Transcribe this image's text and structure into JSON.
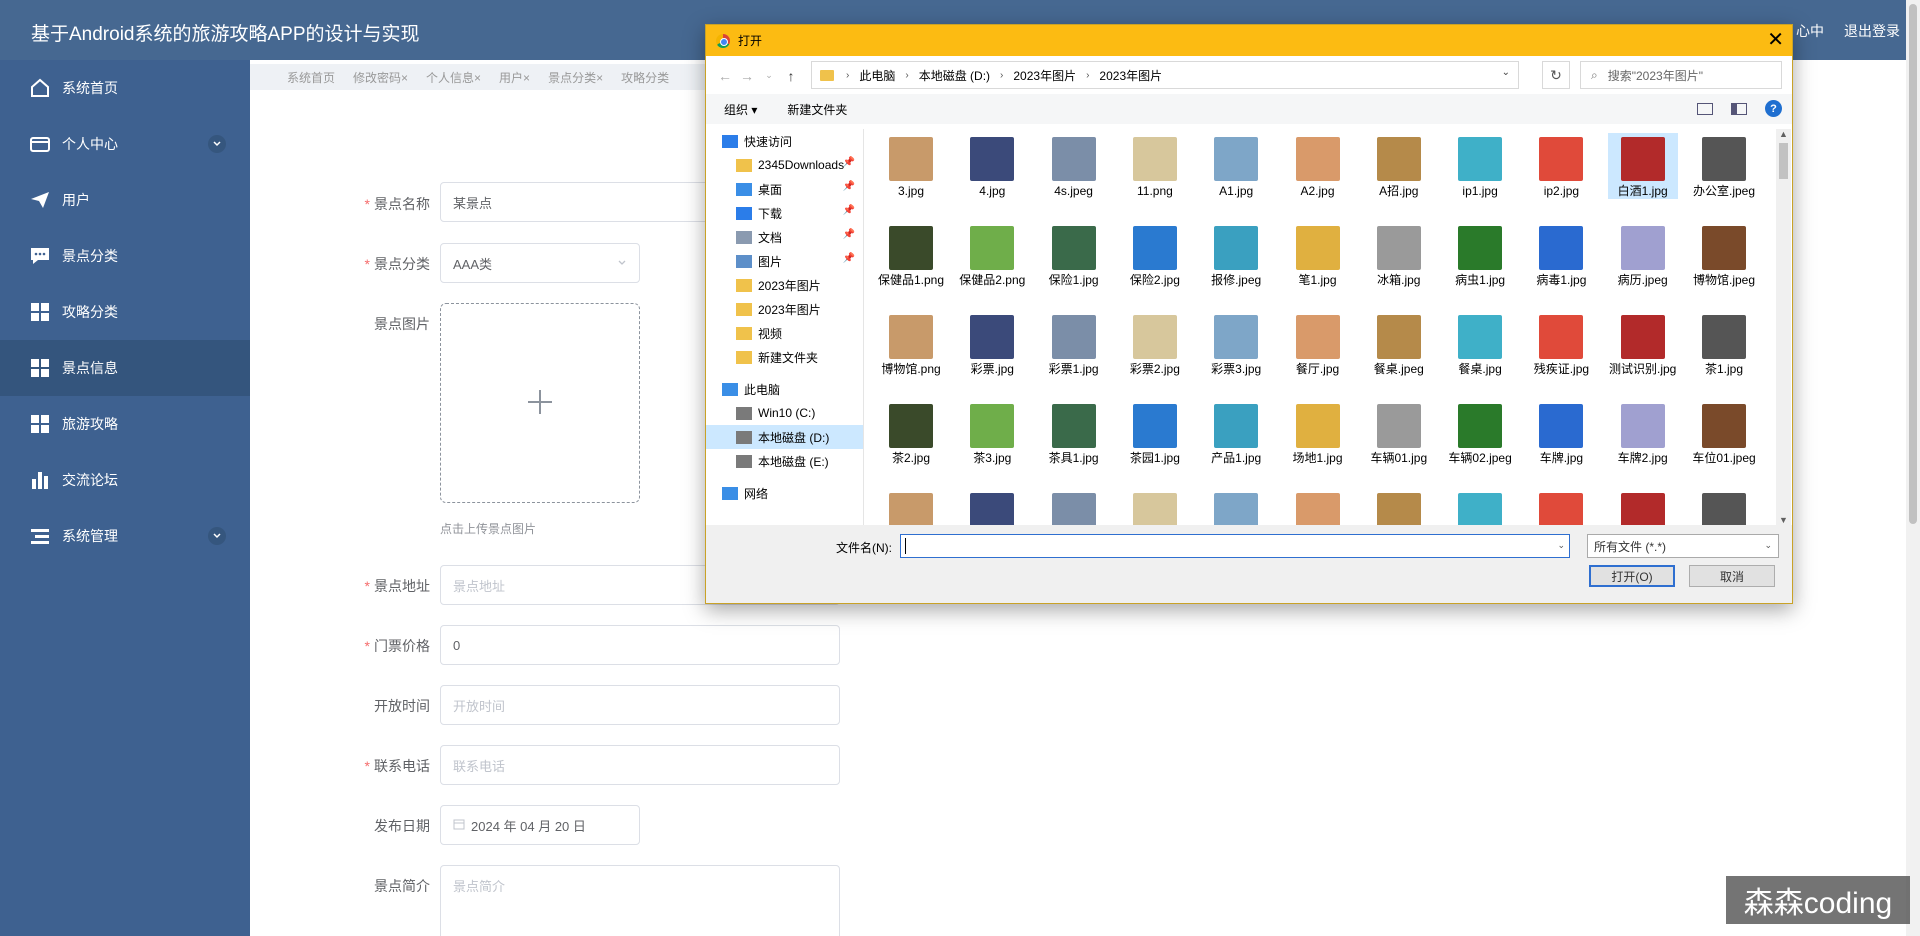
{
  "app": {
    "title": "基于Android系统的旅游攻略APP的设计与实现",
    "top_links": [
      "心中",
      "退出登录"
    ]
  },
  "sidebar": {
    "items": [
      {
        "label": "系统首页"
      },
      {
        "label": "个人中心"
      },
      {
        "label": "用户"
      },
      {
        "label": "景点分类"
      },
      {
        "label": "攻略分类"
      },
      {
        "label": "景点信息"
      },
      {
        "label": "旅游攻略"
      },
      {
        "label": "交流论坛"
      },
      {
        "label": "系统管理"
      }
    ]
  },
  "tags": [
    "系统首页",
    "修改密码×",
    "个人信息×",
    "用户×",
    "景点分类×",
    "攻略分类"
  ],
  "form": {
    "name": {
      "label": "景点名称",
      "value": "某景点"
    },
    "category": {
      "label": "景点分类",
      "value": "AAA类"
    },
    "image": {
      "label": "景点图片",
      "tip": "点击上传景点图片"
    },
    "address": {
      "label": "景点地址",
      "placeholder": "景点地址"
    },
    "price": {
      "label": "门票价格",
      "value": "0"
    },
    "hours": {
      "label": "开放时间",
      "placeholder": "开放时间"
    },
    "phone": {
      "label": "联系电话",
      "placeholder": "联系电话"
    },
    "date": {
      "label": "发布日期",
      "value": "2024 年 04 月 20 日"
    },
    "intro": {
      "label": "景点简介",
      "placeholder": "景点简介"
    }
  },
  "dialog": {
    "title": "打开",
    "breadcrumb": [
      "此电脑",
      "本地磁盘 (D:)",
      "2023年图片",
      "2023年图片"
    ],
    "search_placeholder": "搜索\"2023年图片\"",
    "toolbar": {
      "organize": "组织 ▾",
      "new_folder": "新建文件夹"
    },
    "nav": [
      {
        "label": "快速访问",
        "icon": "star-icon"
      },
      {
        "label": "2345Downloads",
        "icon": "folder-icon",
        "pin": true
      },
      {
        "label": "桌面",
        "icon": "desktop-icon",
        "pin": true
      },
      {
        "label": "下载",
        "icon": "download-icon",
        "pin": true
      },
      {
        "label": "文档",
        "icon": "document-icon",
        "pin": true
      },
      {
        "label": "图片",
        "icon": "picture-icon",
        "pin": true
      },
      {
        "label": "2023年图片",
        "icon": "folder-icon"
      },
      {
        "label": "2023年图片",
        "icon": "folder-icon"
      },
      {
        "label": "视频",
        "icon": "folder-icon"
      },
      {
        "label": "新建文件夹",
        "icon": "folder-icon"
      },
      {
        "label": "此电脑",
        "icon": "pc-icon"
      },
      {
        "label": "Win10 (C:)",
        "icon": "drive-icon"
      },
      {
        "label": "本地磁盘 (D:)",
        "icon": "drive-icon",
        "selected": true
      },
      {
        "label": "本地磁盘 (E:)",
        "icon": "drive-icon"
      },
      {
        "label": "网络",
        "icon": "network-icon"
      }
    ],
    "files": [
      "3.jpg",
      "4.jpg",
      "4s.jpeg",
      "11.png",
      "A1.jpg",
      "A2.jpg",
      "A招.jpg",
      "ip1.jpg",
      "ip2.jpg",
      "白酒1.jpg",
      "办公室.jpeg",
      "保健品1.png",
      "保健品2.png",
      "保险1.jpg",
      "保险2.jpg",
      "报修.jpeg",
      "笔1.jpg",
      "冰箱.jpg",
      "病虫1.jpg",
      "病毒1.jpg",
      "病历.jpeg",
      "博物馆.jpeg",
      "博物馆.png",
      "彩票.jpg",
      "彩票1.jpg",
      "彩票2.jpg",
      "彩票3.jpg",
      "餐厅.jpg",
      "餐桌.jpeg",
      "餐桌.jpg",
      "残疾证.jpg",
      "测试识别.jpg",
      "茶1.jpg",
      "茶2.jpg",
      "茶3.jpg",
      "茶具1.jpg",
      "茶园1.jpg",
      "产品1.jpg",
      "场地1.jpg",
      "车辆01.jpg",
      "车辆02.jpeg",
      "车牌.jpg",
      "车牌2.jpg",
      "车位01.jpeg",
      "",
      "",
      "",
      "",
      "",
      "",
      "",
      "",
      "",
      "",
      ""
    ],
    "selected_file": "白酒1.jpg",
    "filename_label": "文件名(N):",
    "filename_value": "",
    "filter_value": "所有文件 (*.*)",
    "open_button": "打开(O)",
    "cancel_button": "取消"
  },
  "watermark": "森森coding",
  "colors": {
    "topbar": "#466891",
    "sidebar": "#3e6190",
    "dialog_title": "#fcbb12"
  }
}
